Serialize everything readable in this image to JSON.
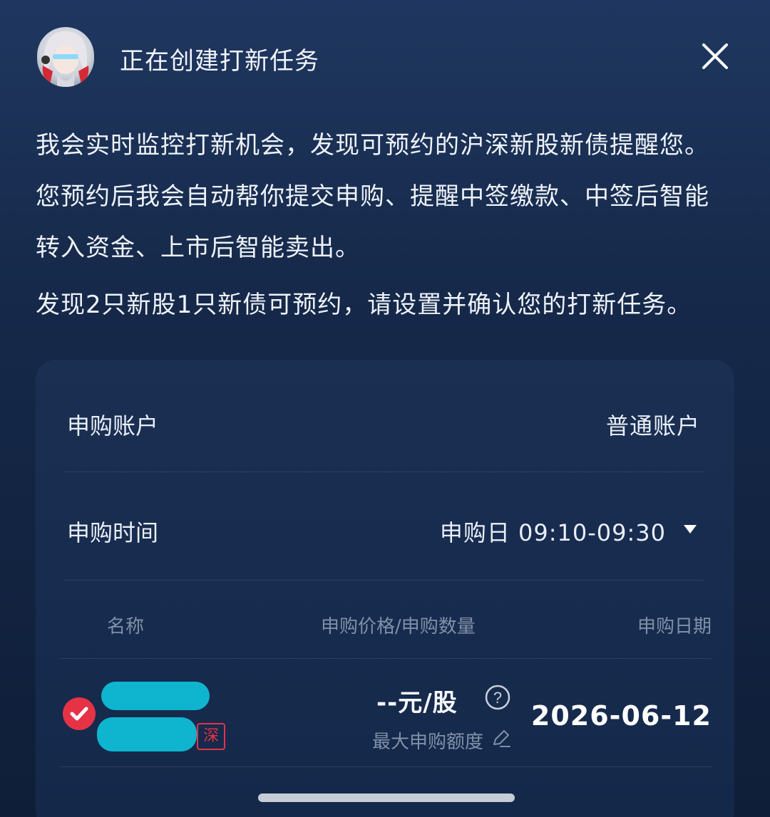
{
  "header": {
    "title": "正在创建打新任务"
  },
  "intro": {
    "line1": "我会实时监控打新机会，发现可预约的沪深新股新债提醒您。",
    "line2": "您预约后我会自动帮你提交申购、提醒中签缴款、中签后智能",
    "line3": "转入资金、上市后智能卖出。",
    "found": "发现2只新股1只新债可预约，请设置并确认您的打新任务。"
  },
  "form": {
    "account_label": "申购账户",
    "account_value": "普通账户",
    "time_label": "申购时间",
    "time_value": "申购日  09:10-09:30"
  },
  "table": {
    "headers": {
      "name": "名称",
      "price_qty": "申购价格/申购数量",
      "date": "申购日期"
    },
    "rows": [
      {
        "market_tag": "深",
        "price": "--元/股",
        "max_label": "最大申购额度",
        "date": "2026-06-12",
        "checked": true
      }
    ]
  },
  "colors": {
    "accent_red": "#e53345",
    "redaction": "#0fb5cf"
  }
}
